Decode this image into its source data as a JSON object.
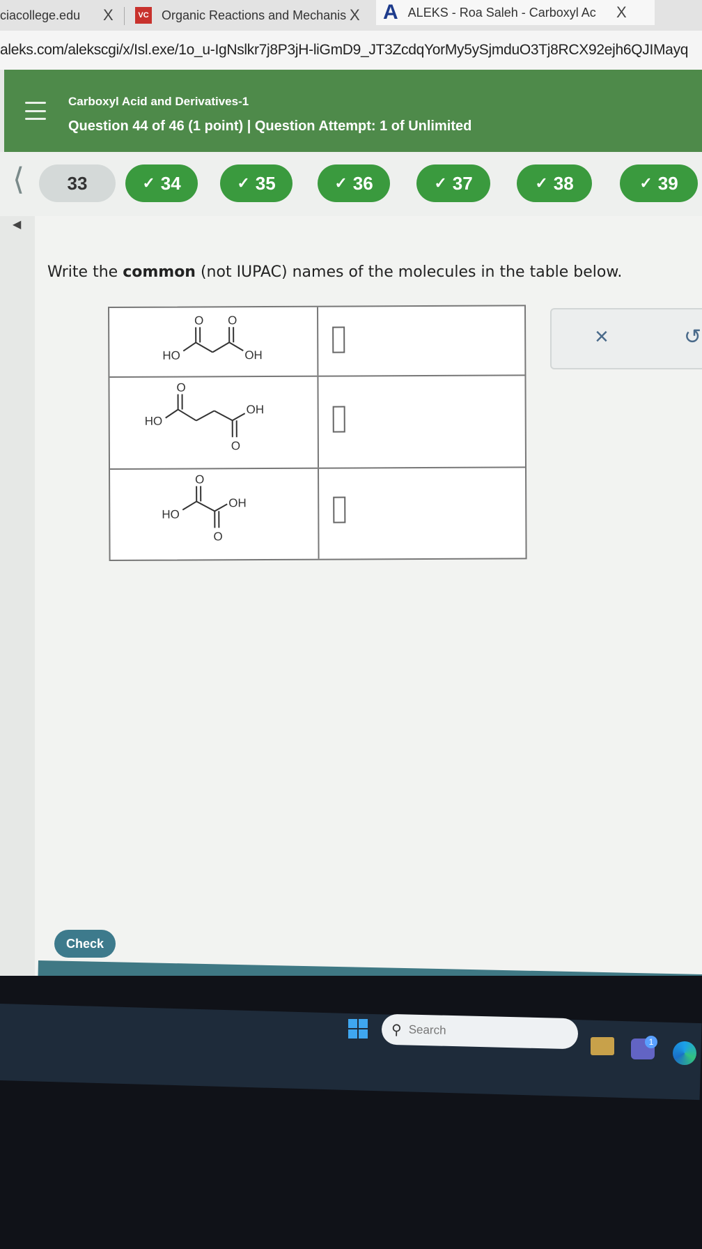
{
  "browser": {
    "tabs": [
      {
        "label": "ciacollege.edu"
      },
      {
        "label": "Organic Reactions and Mechanis",
        "favicon_text": "VC"
      },
      {
        "label": "ALEKS - Roa Saleh - Carboxyl Ac",
        "favicon_text": "A"
      }
    ],
    "close_glyph": "X",
    "url": "aleks.com/alekscgi/x/Isl.exe/1o_u-IgNslkr7j8P3jH-liGmD9_JT3ZcdqYorMy5ySjmduO3Tj8RCX92ejh6QJIMayq"
  },
  "header": {
    "course_title": "Carboxyl Acid and Derivatives-1",
    "question_info": "Question 44 of 46 (1 point)  |  Question Attempt: 1 of Unlimited"
  },
  "nav": {
    "questions": [
      {
        "label": "33",
        "done": false
      },
      {
        "label": "34",
        "done": true
      },
      {
        "label": "35",
        "done": true
      },
      {
        "label": "36",
        "done": true
      },
      {
        "label": "37",
        "done": true
      },
      {
        "label": "38",
        "done": true
      },
      {
        "label": "39",
        "done": true
      }
    ],
    "check_glyph": "✓"
  },
  "question": {
    "prompt_before": "Write the ",
    "prompt_bold": "common",
    "prompt_after": " (not IUPAC) names of the molecules in the table below.",
    "atom_labels": {
      "oxygen": "O",
      "ho": "HO",
      "oh": "OH"
    }
  },
  "side_panel": {
    "clear_glyph": "×",
    "undo_glyph": "↺"
  },
  "check_label": "Check",
  "taskbar": {
    "search_placeholder": "Search",
    "badge": "1"
  },
  "colors": {
    "header_green": "#4e8a4a",
    "done_pill": "#3a9a3e",
    "check_button": "#3d7a8c"
  }
}
